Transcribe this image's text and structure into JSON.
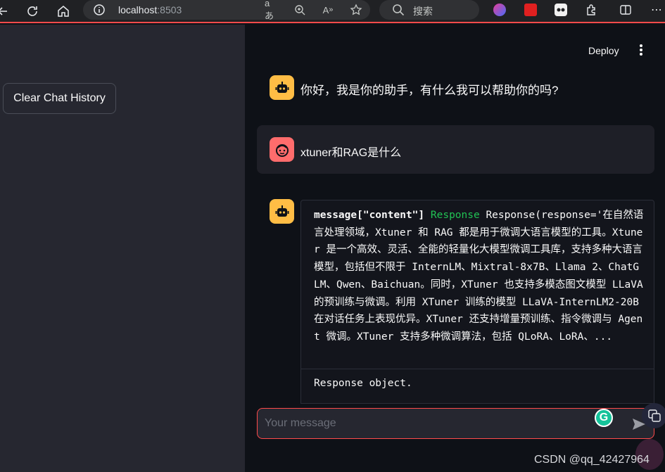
{
  "browser": {
    "address_host": "localhost",
    "address_port": ":8503",
    "search_placeholder": "搜索"
  },
  "sidebar": {
    "clear_button_label": "Clear Chat History"
  },
  "header": {
    "deploy_label": "Deploy"
  },
  "messages": [
    {
      "role": "assistant",
      "avatar": "robot-icon",
      "text": "你好，我是你的助手，有什么我可以帮助你的吗?"
    },
    {
      "role": "user",
      "avatar": "face-icon",
      "text": "xtuner和RAG是什么"
    }
  ],
  "response": {
    "key_label": "message[\"content\"]",
    "type_label": "Response",
    "body": "Response(response='在自然语言处理领域，Xtuner 和 RAG 都是用于微调大语言模型的工具。Xtuner 是一个高效、灵活、全能的轻量化大模型微调工具库，支持多种大语言模型，包括但不限于 InternLM、Mixtral-8x7B、Llama 2、ChatGLM、Qwen、Baichuan。同时，XTuner 也支持多模态图文模型 LLaVA 的预训练与微调。利用 XTuner 训练的模型 LLaVA-InternLM2-20B 在对话任务上表现优异。XTuner 还支持增量预训练、指令微调与 Agent 微调。XTuner 支持多种微调算法，包括 QLoRA、LoRA、...",
    "object_label": "Response object."
  },
  "chat_input": {
    "placeholder": "Your message"
  },
  "watermark": "CSDN @qq_42427964",
  "colors": {
    "accent": "#ff4b4b",
    "bot_avatar": "#ffbd45",
    "user_avatar": "#ff6c6c",
    "type_green": "#21c354"
  }
}
